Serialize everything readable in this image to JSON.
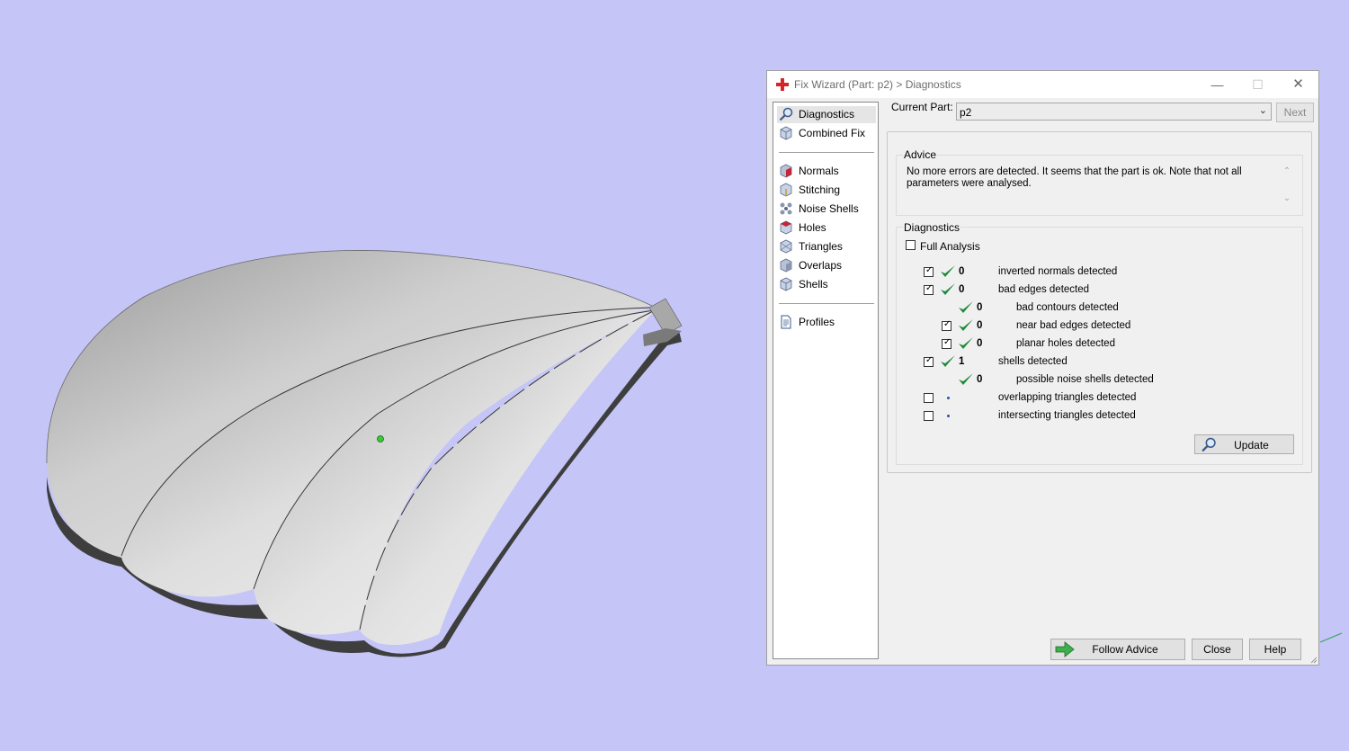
{
  "dialog": {
    "title": "Fix Wizard (Part: p2) > Diagnostics",
    "window_buttons": {
      "minimize": "—",
      "maximize": "☐",
      "close": "✕"
    }
  },
  "nav": {
    "top_items": [
      {
        "label": "Diagnostics",
        "icon": "magnifier-icon",
        "selected": true
      },
      {
        "label": "Combined Fix",
        "icon": "cube-icon"
      }
    ],
    "fix_items": [
      {
        "label": "Normals",
        "icon": "normals-cube-icon"
      },
      {
        "label": "Stitching",
        "icon": "stitching-cube-icon"
      },
      {
        "label": "Noise Shells",
        "icon": "noise-shells-icon"
      },
      {
        "label": "Holes",
        "icon": "holes-cube-icon"
      },
      {
        "label": "Triangles",
        "icon": "triangles-cube-icon"
      },
      {
        "label": "Overlaps",
        "icon": "overlaps-cube-icon"
      },
      {
        "label": "Shells",
        "icon": "shells-cube-icon"
      }
    ],
    "bottom_items": [
      {
        "label": "Profiles",
        "icon": "document-icon"
      }
    ]
  },
  "current_part": {
    "label": "Current Part:",
    "value": "p2"
  },
  "next_button": "Next",
  "advice": {
    "title": "Advice",
    "text": "No more errors are detected. It seems that the part is ok. Note that not all parameters were analysed."
  },
  "diagnostics": {
    "title": "Diagnostics",
    "full_analysis": {
      "label": "Full Analysis",
      "checked": false
    },
    "rows": [
      {
        "count": "0",
        "label": "inverted normals detected",
        "checked": true,
        "status": "ok"
      },
      {
        "count": "0",
        "label": "bad edges detected",
        "checked": true,
        "status": "ok"
      },
      {
        "count": "0",
        "label": "bad contours detected",
        "checked": null,
        "status": "ok"
      },
      {
        "count": "0",
        "label": "near bad edges detected",
        "checked": true,
        "status": "ok"
      },
      {
        "count": "0",
        "label": "planar holes detected",
        "checked": true,
        "status": "ok"
      },
      {
        "count": "1",
        "label": "shells detected",
        "checked": true,
        "status": "ok"
      },
      {
        "count": "0",
        "label": "possible noise shells detected",
        "checked": null,
        "status": "ok"
      },
      {
        "count": "",
        "label": "overlapping triangles detected",
        "checked": false,
        "status": "pending"
      },
      {
        "count": "",
        "label": "intersecting triangles detected",
        "checked": false,
        "status": "pending"
      }
    ],
    "update_button": "Update"
  },
  "footer": {
    "follow_advice": "Follow Advice",
    "close": "Close",
    "help": "Help"
  },
  "colors": {
    "viewport_background": "#c5c5f8",
    "dialog_background": "#f0f0f0",
    "check_green": "#1e8a3c",
    "title_icon_red": "#d8232a"
  }
}
